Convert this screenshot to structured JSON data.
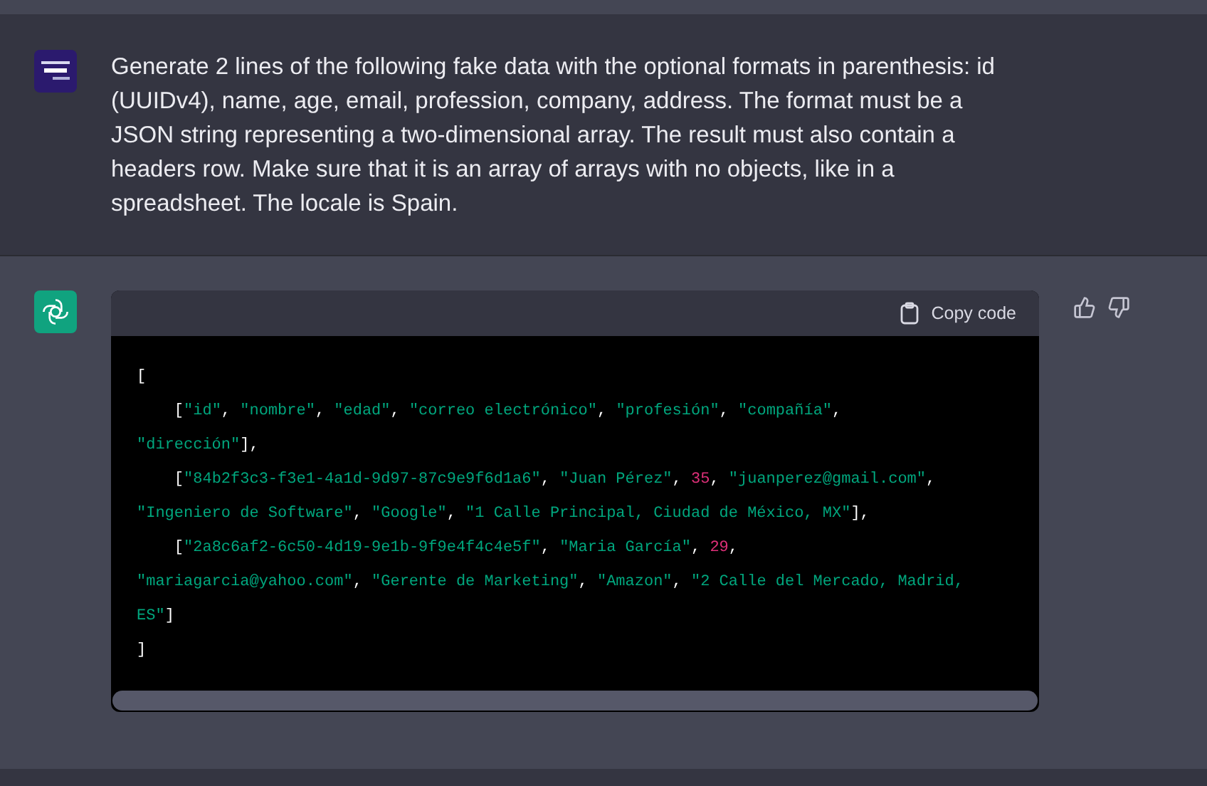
{
  "user_message": {
    "text": "Generate 2 lines of the following fake data with the optional formats in parenthesis: id (UUIDv4), name, age, email, profession, company, address. The format must be a JSON string representing a two-dimensional array. The result must also contain a headers row. Make sure that it is an array of arrays with no objects, like in a spreadsheet. The locale is Spain."
  },
  "assistant_message": {
    "code_block": {
      "copy_button": "Copy code",
      "lines": [
        [
          {
            "kind": "punct",
            "text": "["
          }
        ],
        [
          {
            "kind": "punct",
            "text": "    ["
          },
          {
            "kind": "string",
            "text": "\"id\""
          },
          {
            "kind": "punct",
            "text": ", "
          },
          {
            "kind": "string",
            "text": "\"nombre\""
          },
          {
            "kind": "punct",
            "text": ", "
          },
          {
            "kind": "string",
            "text": "\"edad\""
          },
          {
            "kind": "punct",
            "text": ", "
          },
          {
            "kind": "string",
            "text": "\"correo electrónico\""
          },
          {
            "kind": "punct",
            "text": ", "
          },
          {
            "kind": "string",
            "text": "\"profesión\""
          },
          {
            "kind": "punct",
            "text": ", "
          },
          {
            "kind": "string",
            "text": "\"compañía\""
          },
          {
            "kind": "punct",
            "text": ","
          }
        ],
        [
          {
            "kind": "string",
            "text": "\"dirección\""
          },
          {
            "kind": "punct",
            "text": "],"
          }
        ],
        [
          {
            "kind": "punct",
            "text": "    ["
          },
          {
            "kind": "string",
            "text": "\"84b2f3c3-f3e1-4a1d-9d97-87c9e9f6d1a6\""
          },
          {
            "kind": "punct",
            "text": ", "
          },
          {
            "kind": "string",
            "text": "\"Juan Pérez\""
          },
          {
            "kind": "punct",
            "text": ", "
          },
          {
            "kind": "number",
            "text": "35"
          },
          {
            "kind": "punct",
            "text": ", "
          },
          {
            "kind": "string",
            "text": "\"juanperez@gmail.com\""
          },
          {
            "kind": "punct",
            "text": ","
          }
        ],
        [
          {
            "kind": "string",
            "text": "\"Ingeniero de Software\""
          },
          {
            "kind": "punct",
            "text": ", "
          },
          {
            "kind": "string",
            "text": "\"Google\""
          },
          {
            "kind": "punct",
            "text": ", "
          },
          {
            "kind": "string",
            "text": "\"1 Calle Principal, Ciudad de México, MX\""
          },
          {
            "kind": "punct",
            "text": "],"
          }
        ],
        [
          {
            "kind": "punct",
            "text": "    ["
          },
          {
            "kind": "string",
            "text": "\"2a8c6af2-6c50-4d19-9e1b-9f9e4f4c4e5f\""
          },
          {
            "kind": "punct",
            "text": ", "
          },
          {
            "kind": "string",
            "text": "\"Maria García\""
          },
          {
            "kind": "punct",
            "text": ", "
          },
          {
            "kind": "number",
            "text": "29"
          },
          {
            "kind": "punct",
            "text": ","
          }
        ],
        [
          {
            "kind": "string",
            "text": "\"mariagarcia@yahoo.com\""
          },
          {
            "kind": "punct",
            "text": ", "
          },
          {
            "kind": "string",
            "text": "\"Gerente de Marketing\""
          },
          {
            "kind": "punct",
            "text": ", "
          },
          {
            "kind": "string",
            "text": "\"Amazon\""
          },
          {
            "kind": "punct",
            "text": ", "
          },
          {
            "kind": "string",
            "text": "\"2 Calle del Mercado, Madrid,"
          }
        ],
        [
          {
            "kind": "string",
            "text": "ES\""
          },
          {
            "kind": "punct",
            "text": "]"
          }
        ],
        [
          {
            "kind": "punct",
            "text": "]"
          }
        ]
      ]
    }
  }
}
